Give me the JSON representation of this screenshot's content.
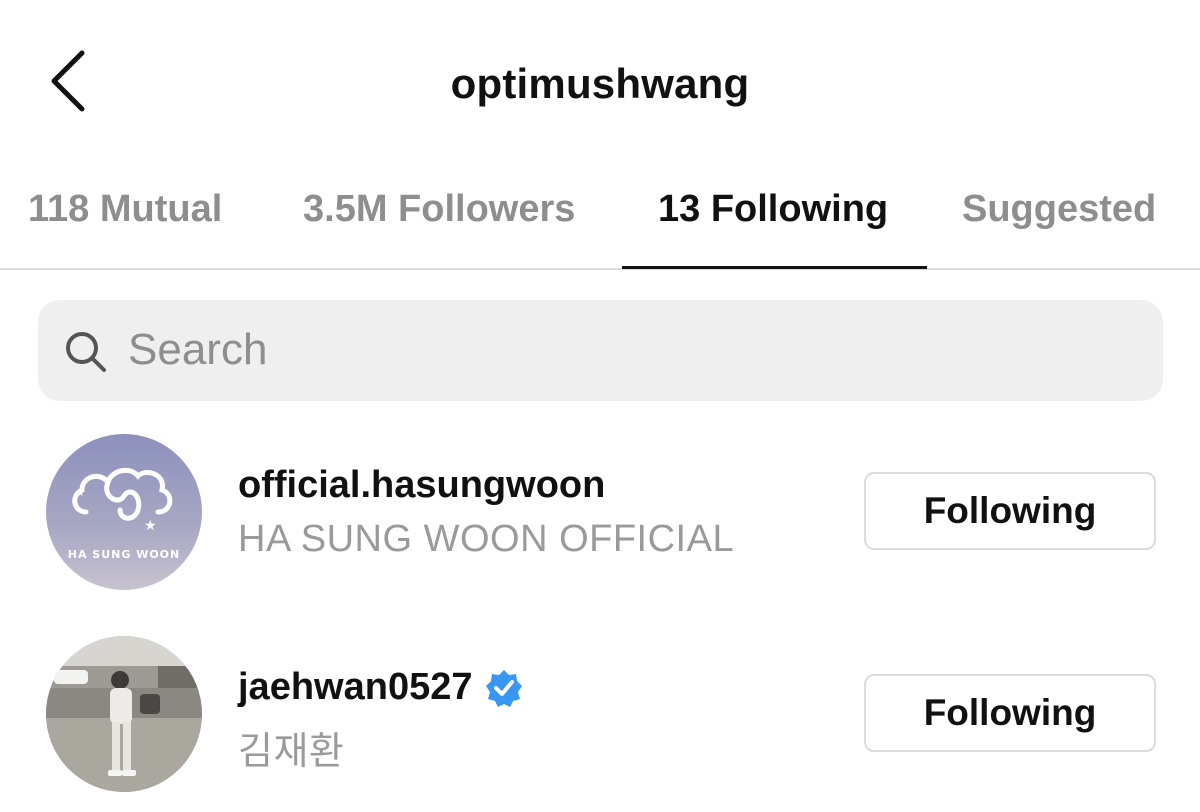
{
  "header": {
    "title": "optimushwang",
    "back_icon": "chevron-left-icon"
  },
  "tabs": [
    {
      "label": "118 Mutual",
      "active": false
    },
    {
      "label": "3.5M Followers",
      "active": false
    },
    {
      "label": "13 Following",
      "active": true
    },
    {
      "label": "Suggested",
      "active": false
    }
  ],
  "search": {
    "placeholder": "Search",
    "value": "",
    "icon": "search-icon"
  },
  "accounts": [
    {
      "username": "official.hasungwoon",
      "full_name": "HA SUNG WOON OFFICIAL",
      "verified": false,
      "button_label": "Following",
      "avatar_text": "HA SUNG WOON"
    },
    {
      "username": "jaehwan0527",
      "full_name": "김재환",
      "verified": true,
      "button_label": "Following"
    }
  ],
  "colors": {
    "verified_badge": "#3897f0",
    "muted_text": "#8e8e8e",
    "search_bg": "#efefef",
    "divider": "#dbdbdb"
  }
}
